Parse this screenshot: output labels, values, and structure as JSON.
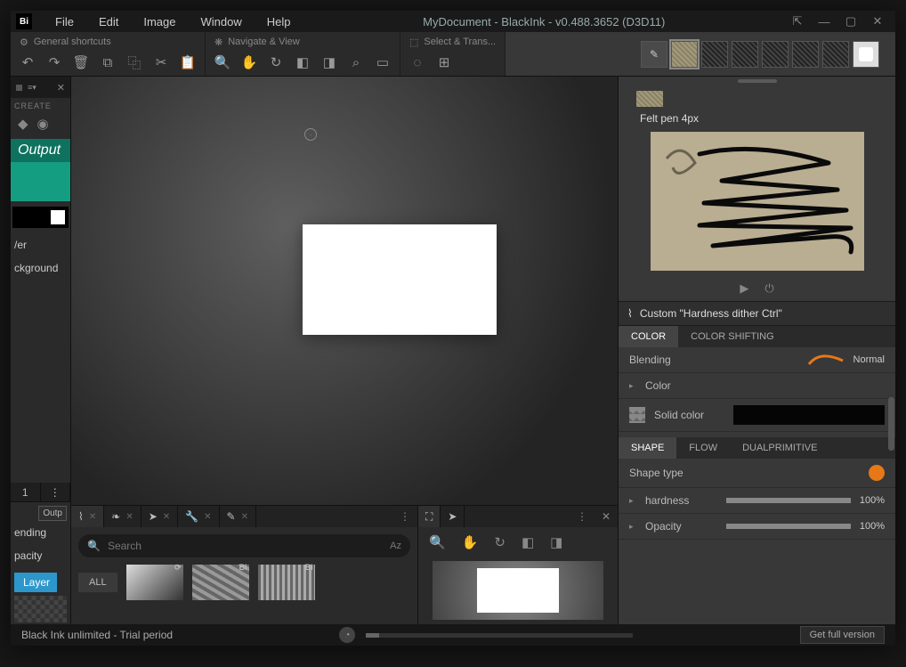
{
  "menubar": {
    "logo": "Bi",
    "items": [
      "File",
      "Edit",
      "Image",
      "Window",
      "Help"
    ],
    "title": "MyDocument - BlackInk  - v0.488.3652 (D3D11)"
  },
  "ribbon": {
    "g1_label": "General shortcuts",
    "g2_label": "Navigate & View",
    "g3_label": "Select & Trans..."
  },
  "leftdock": {
    "create_label": "CREATE",
    "output_label": "Output",
    "layer_row": "/er",
    "bg_row": "ckground",
    "blending": "ending",
    "opacity": "pacity",
    "tab_num": "1",
    "layer_pill": "Layer",
    "outp_tag": "Outp"
  },
  "brush": {
    "name": "Felt pen 4px"
  },
  "controller": {
    "title": "Custom \"Hardness dither Ctrl\""
  },
  "colorTabs": {
    "t1": "COLOR",
    "t2": "COLOR SHIFTING"
  },
  "shapeTabs": {
    "t1": "SHAPE",
    "t2": "FLOW",
    "t3": "DUALPRIMITIVE"
  },
  "props": {
    "blending": "Blending",
    "blendingMode": "Normal",
    "color": "Color",
    "solid": "Solid color",
    "shapeType": "Shape type",
    "hardness": "hardness",
    "hardnessVal": "100%",
    "opacity": "Opacity",
    "opacityVal": "100%"
  },
  "search": {
    "placeholder": "Search",
    "az": "Az"
  },
  "thumbs": {
    "all": "ALL"
  },
  "status": {
    "text": "Black Ink unlimited - Trial period",
    "getfull": "Get full version"
  },
  "icons": {
    "undo": "↶",
    "redo": "↷",
    "trash": "🗑",
    "copy": "⧉",
    "dup": "⿻",
    "cut": "✂",
    "paste": "📋",
    "zoom": "🔍",
    "pan": "✋",
    "rotate": "↻",
    "fliph": "◧",
    "flipv": "◨",
    "zoom2": "⌕",
    "fit": "▭",
    "selrect": "◌",
    "selxf": "⊞",
    "gear": "⚙",
    "play": "▶",
    "power": "⏻",
    "brush": "⌇"
  }
}
